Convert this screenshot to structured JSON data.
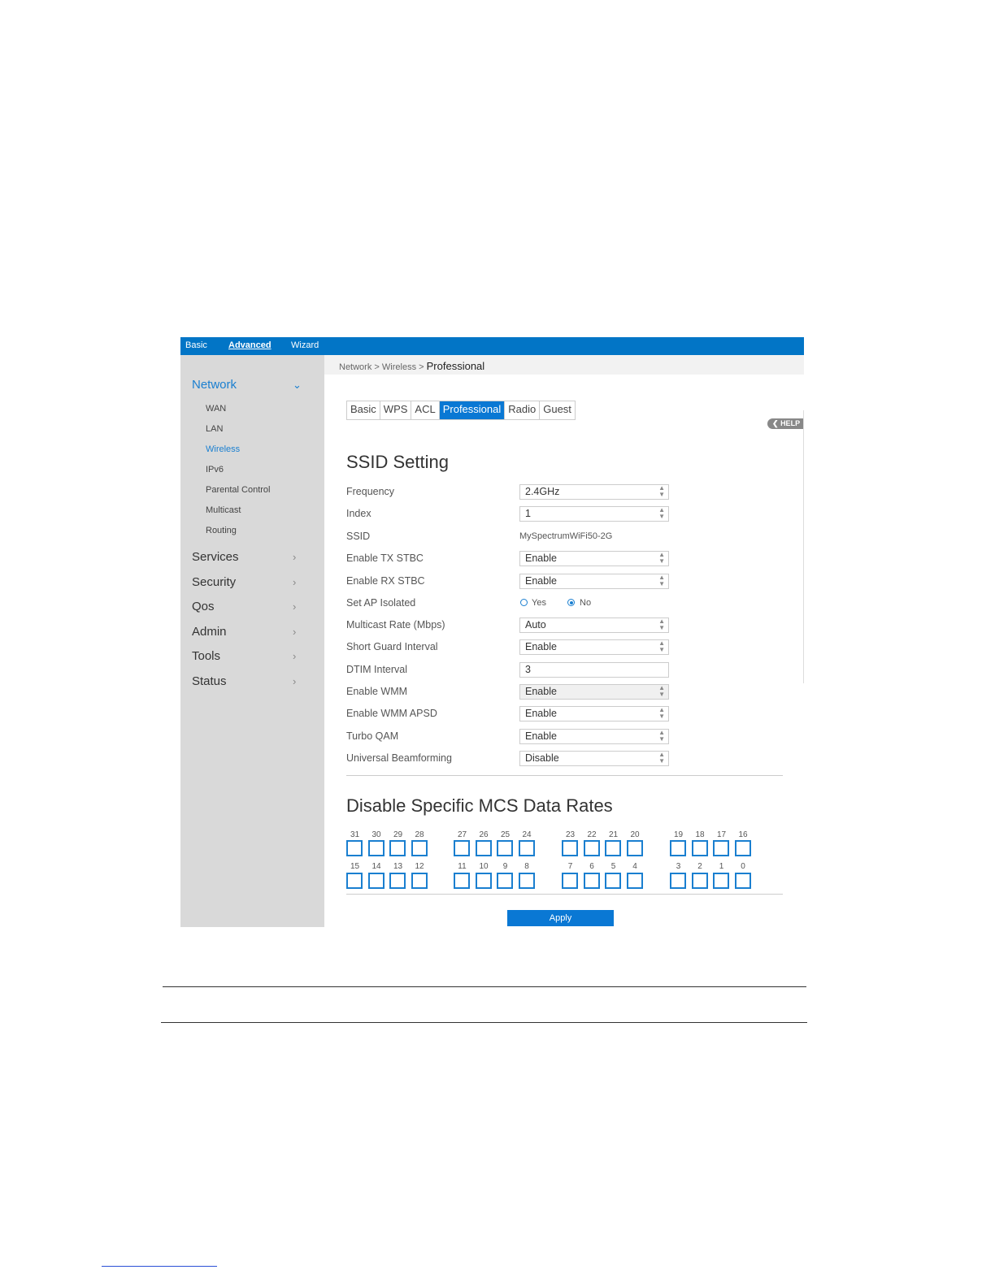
{
  "topnav": {
    "basic": "Basic",
    "advanced": "Advanced",
    "wizard": "Wizard"
  },
  "breadcrumb": {
    "network": "Network",
    "sep1": ">",
    "wireless": "Wireless",
    "sep2": ">",
    "current": "Professional"
  },
  "sidebar": {
    "network": "Network",
    "sub": [
      "WAN",
      "LAN",
      "Wireless",
      "IPv6",
      "Parental Control",
      "Multicast",
      "Routing"
    ],
    "sections": [
      "Services",
      "Security",
      "Qos",
      "Admin",
      "Tools",
      "Status"
    ]
  },
  "tabs": [
    "Basic",
    "WPS",
    "ACL",
    "Professional",
    "Radio",
    "Guest"
  ],
  "help": "HELP",
  "ssid_section": {
    "title": "SSID Setting",
    "fields": [
      {
        "label": "Frequency",
        "value": "2.4GHz"
      },
      {
        "label": "Index",
        "value": "1"
      },
      {
        "label": "SSID",
        "value": "MySpectrumWiFi50-2G"
      },
      {
        "label": "Enable TX STBC",
        "value": "Enable"
      },
      {
        "label": "Enable RX STBC",
        "value": "Enable"
      },
      {
        "label": "Set AP Isolated",
        "value": "No"
      },
      {
        "label": "Multicast Rate (Mbps)",
        "value": "Auto"
      },
      {
        "label": "Short Guard Interval",
        "value": "Enable"
      },
      {
        "label": "DTIM Interval",
        "value": "3"
      },
      {
        "label": "Enable WMM",
        "value": "Enable"
      },
      {
        "label": "Enable WMM APSD",
        "value": "Enable"
      },
      {
        "label": "Turbo QAM",
        "value": "Enable"
      },
      {
        "label": "Universal Beamforming",
        "value": "Disable"
      }
    ],
    "radio_yes": "Yes",
    "radio_no": "No"
  },
  "mcs_section": {
    "title": "Disable Specific MCS Data Rates",
    "row1": [
      "31",
      "30",
      "29",
      "28",
      "27",
      "26",
      "25",
      "24",
      "23",
      "22",
      "21",
      "20",
      "19",
      "18",
      "17",
      "16"
    ],
    "row2": [
      "15",
      "14",
      "13",
      "12",
      "11",
      "10",
      "9",
      "8",
      "7",
      "6",
      "5",
      "4",
      "3",
      "2",
      "1",
      "0"
    ]
  },
  "apply": "Apply",
  "colors": {
    "accent": "#0a78d4",
    "topbar": "#0275c6",
    "sidebar": "#d9d9d9"
  }
}
